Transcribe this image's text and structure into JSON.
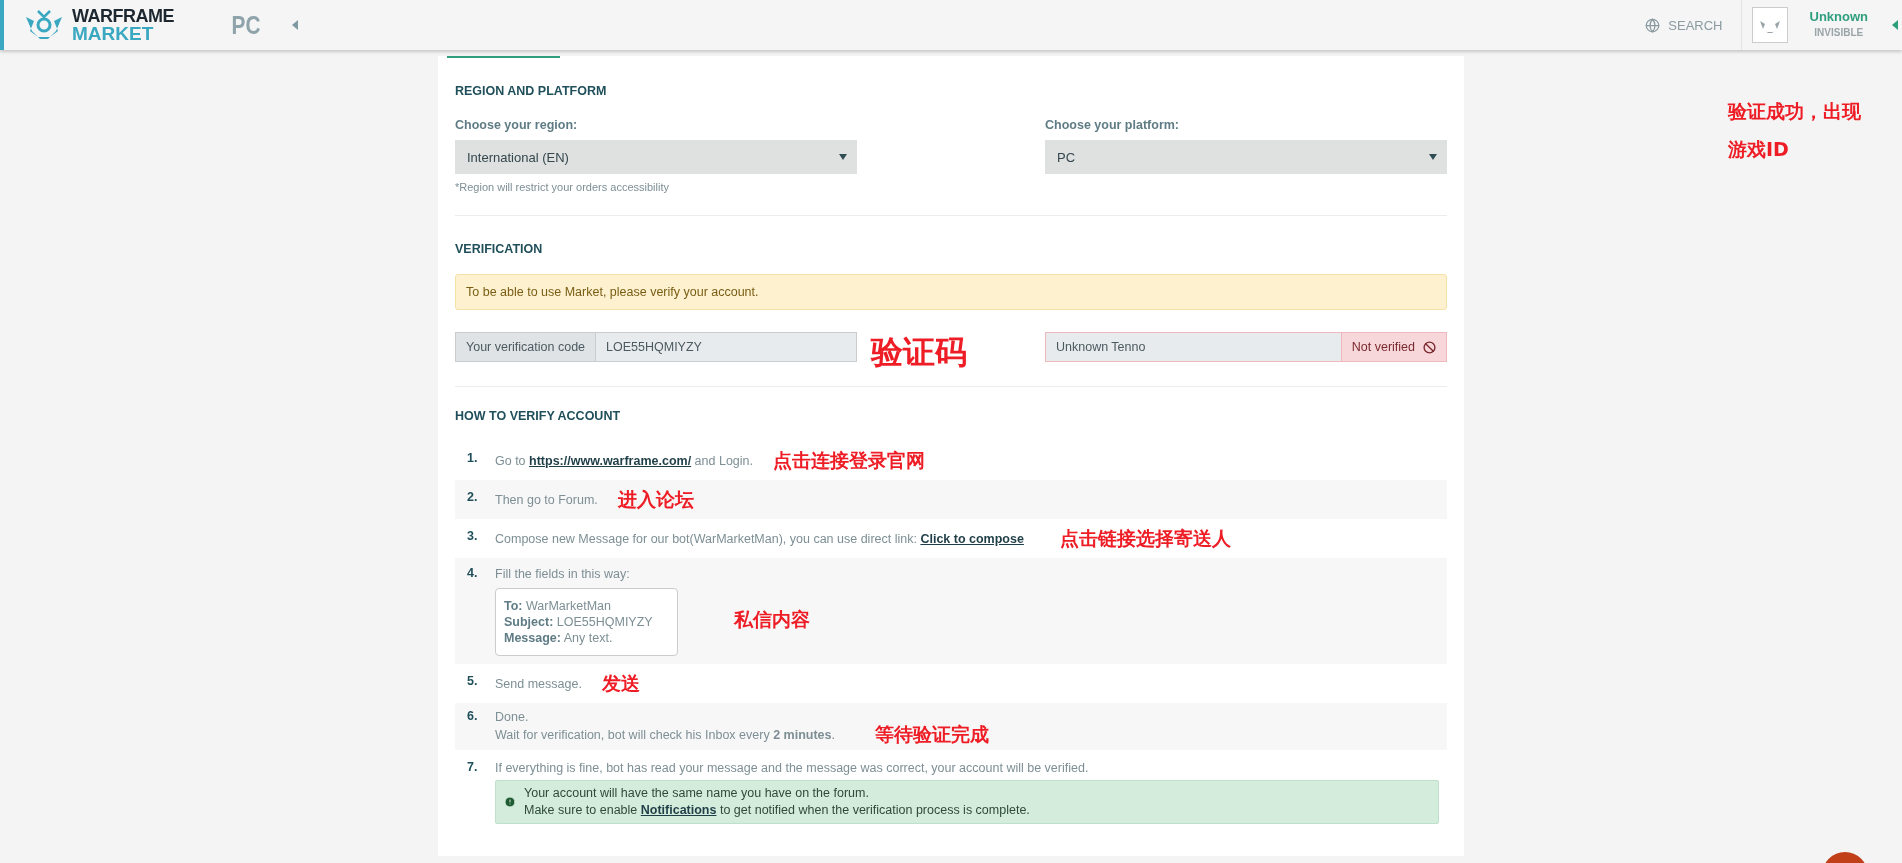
{
  "header": {
    "logo_top": "WARFRAME",
    "logo_bottom": "MARKET",
    "platform": "PC",
    "search": "SEARCH",
    "user": {
      "name": "Unknown",
      "status": "INVISIBLE"
    }
  },
  "corner_note": [
    "验证成功，出现",
    "游戏ID"
  ],
  "region_platform": {
    "title": "REGION AND PLATFORM",
    "region_label": "Choose your region:",
    "region_value": "International (EN)",
    "region_note": "*Region will restrict your orders accessibility",
    "platform_label": "Choose your platform:",
    "platform_value": "PC"
  },
  "verification": {
    "title": "VERIFICATION",
    "warning": "To be able to use Market, please verify your account.",
    "code_label": "Your verification code",
    "code": "LOE55HQMIYZY",
    "code_note": "验证码",
    "name": "Unknown Tenno",
    "status": "Not verified",
    "verified": false
  },
  "how_to": {
    "title": "HOW TO VERIFY ACCOUNT",
    "steps": [
      {
        "number": "1.",
        "text": "Go to ",
        "link": "https://www.warframe.com/",
        "after": " and Login.",
        "note": "点击连接登录官网"
      },
      {
        "number": "2.",
        "text": "Then go to Forum.",
        "note": "进入论坛"
      },
      {
        "number": "3.",
        "text": "Compose new Message for our bot(WarMarketMan), you can use direct link: ",
        "link": "Click to compose",
        "note": "点击链接选择寄送人"
      },
      {
        "number": "4.",
        "text": "Fill the fields in this way:",
        "fields": [
          {
            "label": "To:",
            "value": "WarMarketMan"
          },
          {
            "label": "Subject:",
            "value": "LOE55HQMIYZY"
          },
          {
            "label": "Message:",
            "value": "Any text."
          }
        ],
        "note": "私信内容"
      },
      {
        "number": "5.",
        "text": "Send message.",
        "note": "发送"
      },
      {
        "number": "6.",
        "text": "Done.",
        "second_line": "Wait for verification, bot will check his Inbox every **2 minutes**.",
        "note": "等待验证完成"
      },
      {
        "number": "7.",
        "text": "If everything is fine, bot has read your message and the message was correct, your account will be verified.",
        "info": {
          "line": "Your account will have the same name you have on the forum.",
          "before": "Make sure to enable ",
          "link": "Notifications",
          "after": " to get notified when the verification process is complete."
        }
      }
    ]
  }
}
